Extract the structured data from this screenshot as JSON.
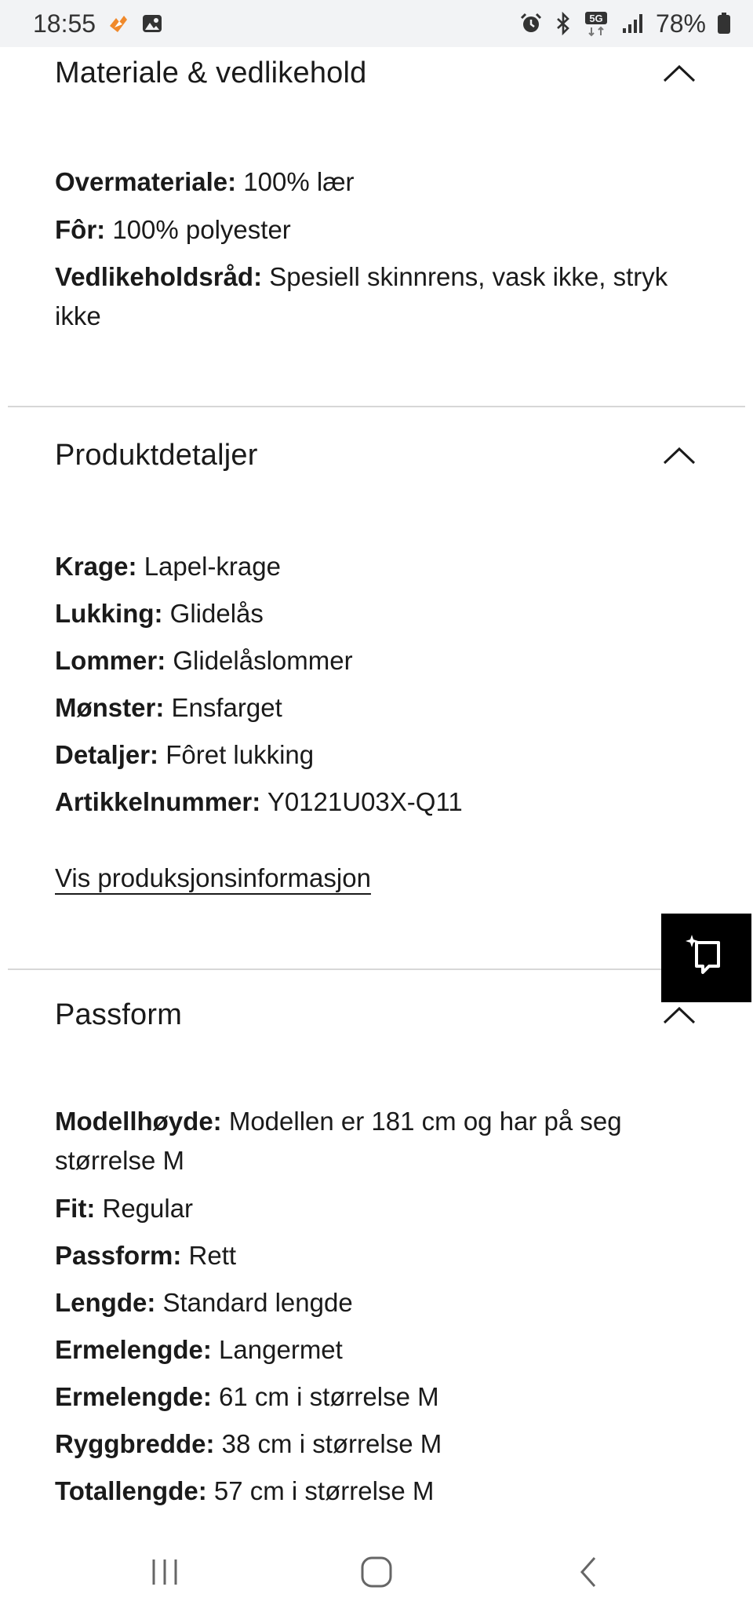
{
  "status_bar": {
    "time": "18:55",
    "battery": "78%",
    "network": "5G",
    "icons": [
      "fire-app-icon",
      "gallery-icon",
      "alarm-icon",
      "bluetooth-icon",
      "5g-icon",
      "signal-icon",
      "battery-icon"
    ]
  },
  "sections": {
    "material": {
      "title": "Materiale & vedlikehold",
      "rows": [
        {
          "label": "Overmateriale:",
          "value": " 100% lær"
        },
        {
          "label": "Fôr:",
          "value": " 100% polyester"
        },
        {
          "label": "Vedlikeholdsråd:",
          "value": " Spesiell skinnrens, vask ikke, stryk ikke"
        }
      ]
    },
    "details": {
      "title": "Produktdetaljer",
      "rows": [
        {
          "label": "Krage:",
          "value": " Lapel-krage"
        },
        {
          "label": "Lukking:",
          "value": " Glidelås"
        },
        {
          "label": "Lommer:",
          "value": " Glidelåslommer"
        },
        {
          "label": "Mønster:",
          "value": " Ensfarget"
        },
        {
          "label": "Detaljer:",
          "value": " Fôret lukking"
        },
        {
          "label": "Artikkelnummer:",
          "value": " Y0121U03X-Q11"
        }
      ],
      "link": "Vis produksjonsinformasjon"
    },
    "fit": {
      "title": "Passform",
      "rows": [
        {
          "label": "Modellhøyde:",
          "value": " Modellen er 181 cm og har på seg størrelse M"
        },
        {
          "label": "Fit:",
          "value": " Regular"
        },
        {
          "label": "Passform:",
          "value": " Rett"
        },
        {
          "label": "Lengde:",
          "value": " Standard lengde"
        },
        {
          "label": "Ermelengde:",
          "value": " Langermet"
        },
        {
          "label": "Ermelengde:",
          "value": " 61 cm i størrelse M"
        },
        {
          "label": "Ryggbredde:",
          "value": " 38 cm i størrelse M"
        },
        {
          "label": "Totallengde:",
          "value": " 57 cm i størrelse M"
        }
      ]
    }
  },
  "fab": {
    "icon": "crop-ai-icon"
  },
  "nav": {
    "icons": [
      "recent-apps-icon",
      "home-icon",
      "back-icon"
    ]
  }
}
